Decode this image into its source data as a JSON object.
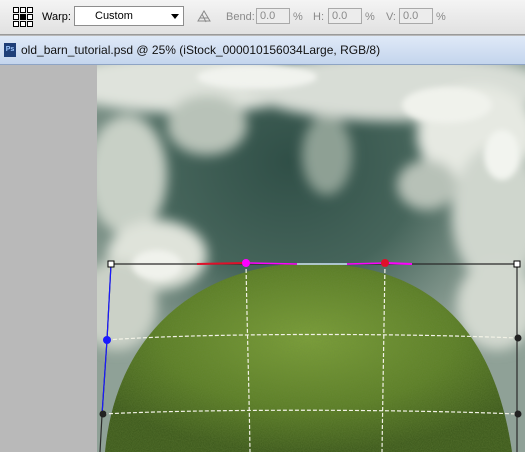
{
  "options_bar": {
    "warp_label": "Warp:",
    "warp_value": "Custom",
    "bend_label": "Bend:",
    "bend_value": "0.0",
    "h_label": "H:",
    "h_value": "0.0",
    "v_label": "V:",
    "v_value": "0.0",
    "percent": "%"
  },
  "document": {
    "title": "old_barn_tutorial.psd @ 25% (iStock_000010156034Large, RGB/8)",
    "app_icon": "Ps"
  },
  "colors": {
    "sky_dark": "#2f4f45",
    "sky_light": "#dfe4de",
    "hedge_green": "#5f8227",
    "handle_blue": "#1a1aff",
    "handle_red": "#e0102a",
    "handle_magenta": "#ff00ff"
  },
  "icons": {
    "reference_point": "reference-point-grid-icon",
    "warp_orientation": "warp-orientation-icon",
    "document": "photoshop-document-icon"
  }
}
